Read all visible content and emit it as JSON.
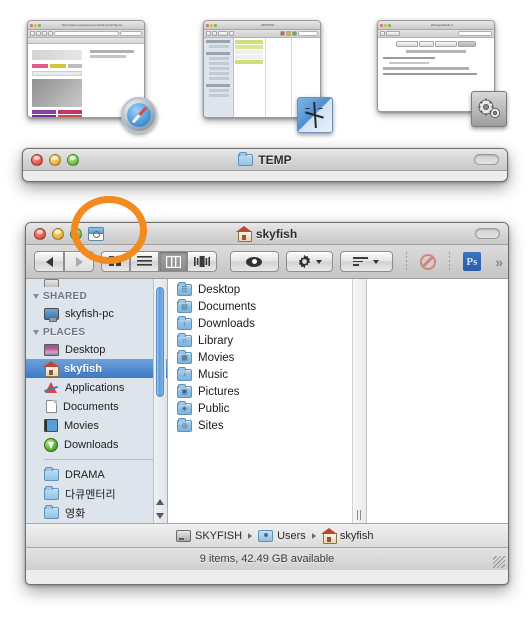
{
  "expose": {
    "label": "expose-window-switcher",
    "items": [
      {
        "app": "Safari",
        "badge_icon": "safari-compass-icon",
        "window_title": "http://www.musicovery.com/index2.php?lg=us",
        "page_heading": "Define your Music",
        "page_sub": "1 more infos + req"
      },
      {
        "app": "Finder",
        "badge_icon": "finder-face-icon",
        "window_title": "BKPDISK"
      },
      {
        "app": "System Preferences",
        "badge_icon": "system-preferences-gears-icon",
        "window_title": "WindowShade X",
        "tabs": [
          "WindowShade X",
          "Settings",
          "Minimize-in-Place",
          "Advanced"
        ],
        "section": "Additional Options for WindowShade X",
        "checkbox1": "Play Sounds When Shading a Window",
        "checkbox2": "Transparent Window Opacity",
        "checkbox3": "Substitute for Double-Clicked Window Titlebar (such as Finder)"
      }
    ]
  },
  "temp_window": {
    "title": "TEMP",
    "folder_icon": "blue-folder-icon",
    "lights": {
      "close": "close-button",
      "minimize": "minimize-button",
      "zoom": "zoom-button"
    },
    "toolbar_toggle": "toolbar-toggle-pill"
  },
  "finder_window": {
    "title": "skyfish",
    "title_icon": "home-folder-icon",
    "shade_icon": "windowshade-icon",
    "lights": {
      "close": "close-button",
      "minimize": "minimize-button",
      "zoom": "zoom-button"
    },
    "toolbar_toggle": "toolbar-toggle-pill",
    "toolbar": {
      "back_label": "Back",
      "forward_label": "Forward",
      "view_icon_label": "Icon View",
      "view_list_label": "List View",
      "view_column_label": "Column View",
      "view_coverflow_label": "Cover Flow View",
      "active_view": "Column View",
      "quicklook_label": "Quick Look",
      "action_label": "Action",
      "arrange_label": "Arrange",
      "noentry_label": "Drop Not Allowed",
      "photoshop_label": "Ps",
      "overflow_label": "»"
    },
    "sidebar": {
      "cut_item_label": "(scrolled item)",
      "groups": [
        {
          "header": "SHARED",
          "items": [
            {
              "label": "skyfish-pc",
              "icon": "display-icon",
              "eject": true,
              "selected": false
            }
          ]
        },
        {
          "header": "PLACES",
          "items": [
            {
              "label": "Desktop",
              "icon": "desktop-icon",
              "selected": false
            },
            {
              "label": "skyfish",
              "icon": "home-icon",
              "selected": true
            },
            {
              "label": "Applications",
              "icon": "applications-icon",
              "selected": false
            },
            {
              "label": "Documents",
              "icon": "documents-icon",
              "selected": false
            },
            {
              "label": "Movies",
              "icon": "movies-icon",
              "selected": false
            },
            {
              "label": "Downloads",
              "icon": "downloads-icon",
              "selected": false
            }
          ]
        },
        {
          "header": "",
          "items": [
            {
              "label": "DRAMA",
              "icon": "folder-icon",
              "selected": false
            },
            {
              "label": "다큐멘터리",
              "icon": "folder-icon",
              "selected": false
            },
            {
              "label": "영화",
              "icon": "folder-icon",
              "selected": false
            }
          ]
        }
      ]
    },
    "columns": {
      "column1": [
        {
          "name": "Desktop",
          "icon": "folder-desktop-icon",
          "glyph": "☰",
          "has_children": true
        },
        {
          "name": "Documents",
          "icon": "folder-documents-icon",
          "glyph": "▤",
          "has_children": true
        },
        {
          "name": "Downloads",
          "icon": "folder-downloads-icon",
          "glyph": "↓",
          "has_children": true
        },
        {
          "name": "Library",
          "icon": "folder-library-icon",
          "glyph": "⌂",
          "has_children": true
        },
        {
          "name": "Movies",
          "icon": "folder-movies-icon",
          "glyph": "▦",
          "has_children": true
        },
        {
          "name": "Music",
          "icon": "folder-music-icon",
          "glyph": "♪",
          "has_children": true
        },
        {
          "name": "Pictures",
          "icon": "folder-pictures-icon",
          "glyph": "▣",
          "has_children": true
        },
        {
          "name": "Public",
          "icon": "folder-public-icon",
          "glyph": "◈",
          "has_children": true
        },
        {
          "name": "Sites",
          "icon": "folder-sites-icon",
          "glyph": "◎",
          "has_children": true
        }
      ],
      "column2": []
    },
    "pathbar": [
      {
        "label": "SKYFISH",
        "icon": "hard-disk-icon"
      },
      {
        "label": "Users",
        "icon": "users-folder-icon"
      },
      {
        "label": "skyfish",
        "icon": "home-icon"
      }
    ],
    "statusbar": {
      "text": "9 items, 42.49 GB available"
    }
  },
  "annotation": {
    "shape": "circle",
    "color": "#f28a1e",
    "target": "windowshade-icon-and-traffic-lights"
  }
}
